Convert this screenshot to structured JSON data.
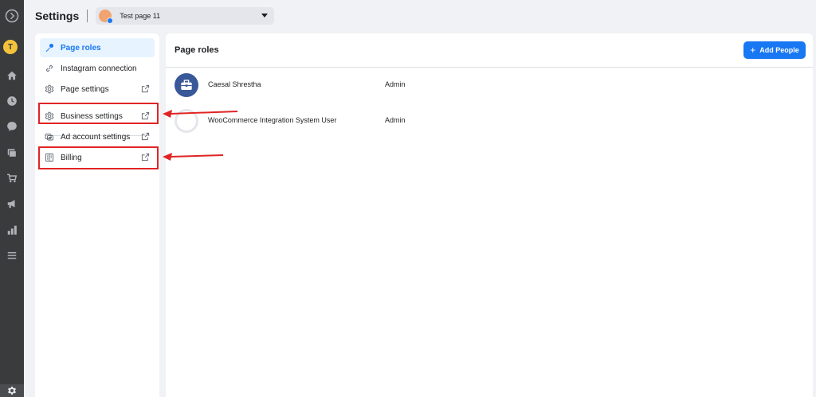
{
  "header": {
    "title": "Settings",
    "page_selector": {
      "selected": "Test page 11"
    }
  },
  "rail": {
    "avatar_letter": "T",
    "icons": [
      "meta-logo-icon",
      "home-icon",
      "clock-icon",
      "chat-icon",
      "pages-icon",
      "shop-icon",
      "megaphone-icon",
      "insights-icon",
      "menu-icon",
      "settings-icon"
    ]
  },
  "sidebar": {
    "items": [
      {
        "label": "Page roles",
        "icon": "key-icon",
        "active": true,
        "external": false
      },
      {
        "label": "Instagram connection",
        "icon": "link-icon",
        "active": false,
        "external": false
      },
      {
        "label": "Page settings",
        "icon": "gear-icon",
        "active": false,
        "external": true
      },
      {
        "label": "Business settings",
        "icon": "gear-icon",
        "active": false,
        "external": true
      },
      {
        "label": "Ad account settings",
        "icon": "ad-account-icon",
        "active": false,
        "external": true
      },
      {
        "label": "Billing",
        "icon": "billing-icon",
        "active": false,
        "external": true
      }
    ]
  },
  "main": {
    "title": "Page roles",
    "add_button_label": "Add People",
    "people": [
      {
        "name": "Caesal Shrestha",
        "role": "Admin",
        "avatar": "briefcase-icon"
      },
      {
        "name": "WooCommerce Integration System User",
        "role": "Admin",
        "avatar": "user-placeholder-icon"
      }
    ]
  },
  "colors": {
    "accent": "#1877f2",
    "highlight": "#e02424",
    "rail": "#3a3b3c"
  }
}
